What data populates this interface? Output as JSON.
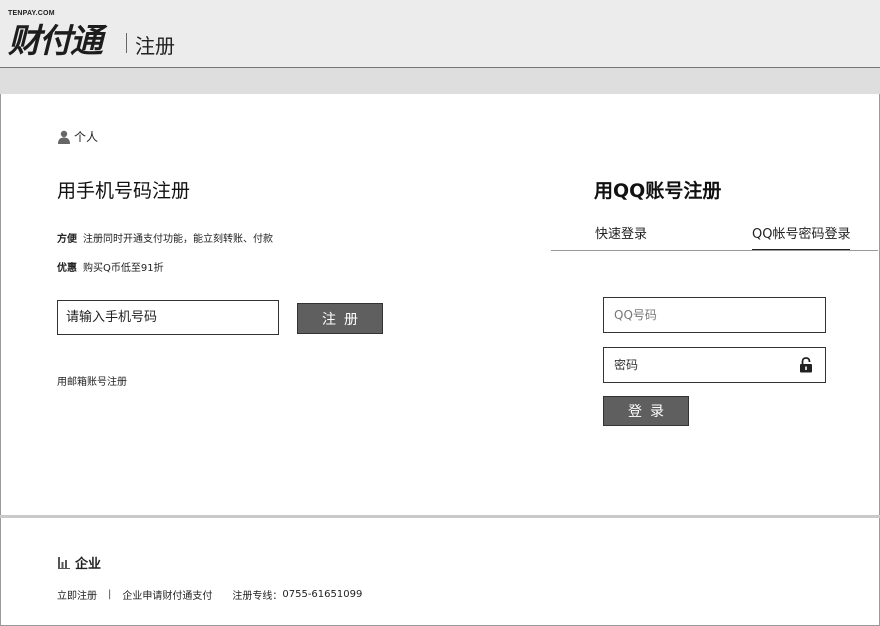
{
  "header": {
    "logo_small": "TENPAY.COM",
    "logo_main": "财付通",
    "title": "注册"
  },
  "personal": {
    "section_label": "个人",
    "phone_heading": "用手机号码注册",
    "perks": [
      {
        "key": "方便",
        "text": "注册同时开通支付功能，能立刻转账、付款"
      },
      {
        "key": "优惠",
        "text": "购买Q币低至91折"
      }
    ],
    "phone_placeholder": "请输入手机号码",
    "register_button": "注册",
    "email_link": "用邮箱账号注册"
  },
  "qq": {
    "heading_prefix": "用",
    "heading_bold": "QQ",
    "heading_suffix": "账号注册",
    "tabs": [
      {
        "label": "快速登录",
        "active": false
      },
      {
        "label": "QQ帐号密码登录",
        "active": true
      }
    ],
    "qq_placeholder": "QQ号码",
    "password_placeholder": "密码",
    "login_button": "登录"
  },
  "enterprise": {
    "section_label": "企业",
    "links": [
      "立即注册",
      "企业申请财付通支付"
    ],
    "separator": "|",
    "hotline_label": "注册专线：",
    "hotline_number": "0755-61651099"
  }
}
